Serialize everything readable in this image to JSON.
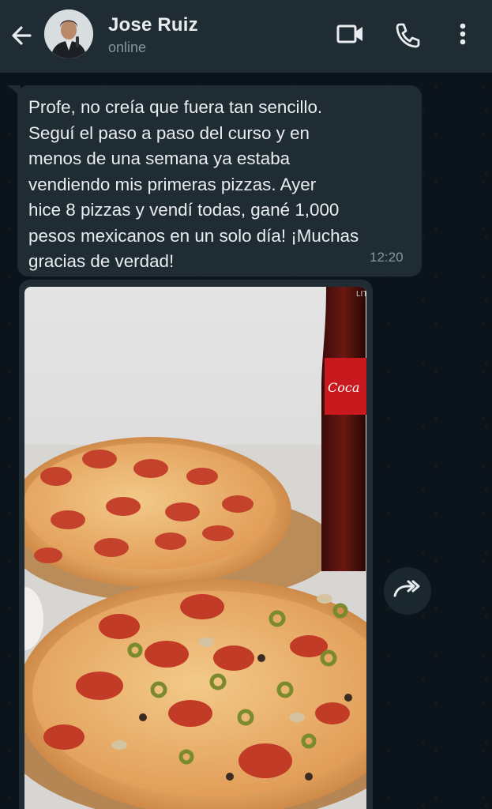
{
  "header": {
    "contact_name": "Jose Ruiz",
    "status": "online",
    "icons": [
      "back-arrow-icon",
      "video-call-icon",
      "phone-icon",
      "more-vert-icon"
    ]
  },
  "messages": [
    {
      "type": "text",
      "direction": "incoming",
      "text": "Profe, no creía que fuera tan sencillo.\nSeguí el paso a paso del curso y en\nmenos de una semana ya estaba\nvendiendo mis primeras pizzas. Ayer\nhice 8 pizzas y vendí todas, gané 1,000\npesos mexicanos en un solo día! ¡Muchas\ngracias de verdad!",
      "time": "12:20"
    },
    {
      "type": "image",
      "direction": "incoming",
      "description_icon": "pizza-photo",
      "bottle_brand": "Coca-Cola",
      "bottle_cap": "LITE"
    }
  ],
  "colors": {
    "header_bg": "#1f2c34",
    "chat_bg": "#0b141a",
    "bubble_bg": "#202c33",
    "primary_text": "#e9edef",
    "secondary_text": "#8696a0"
  }
}
